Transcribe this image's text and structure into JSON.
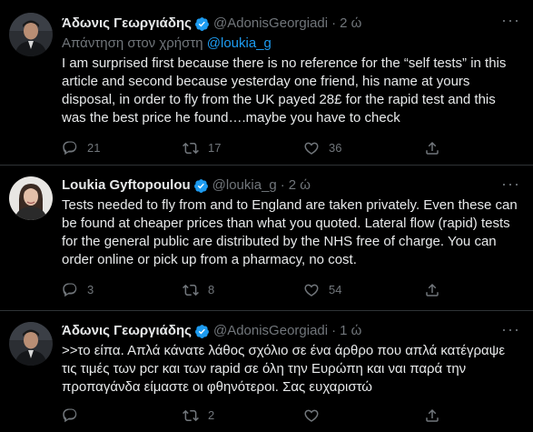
{
  "tweets": [
    {
      "name": "Άδωνις Γεωργιάδης",
      "handle": "@AdonisGeorgiadi",
      "time": "2 ώ",
      "reply_prefix": "Απάντηση στον χρήστη",
      "reply_to": "@loukia_g",
      "text": "I am surprised first because there is no reference for the “self tests” in this article and second because yesterday one friend, his name at yours disposal, in order to fly from the UK payed 28£ for the rapid test and this was the best price he found….maybe you have to check",
      "replies": "21",
      "retweets": "17",
      "likes": "36"
    },
    {
      "name": "Loukia Gyftopoulou",
      "handle": "@loukia_g",
      "time": "2 ώ",
      "text": "Tests needed to fly from and to England are taken privately. Even these can be found at cheaper prices than what you quoted. Lateral flow (rapid) tests for the general public are distributed by the NHS free of charge. You can order online or pick up from a pharmacy, no cost.",
      "replies": "3",
      "retweets": "8",
      "likes": "54"
    },
    {
      "name": "Άδωνις Γεωργιάδης",
      "handle": "@AdonisGeorgiadi",
      "time": "1 ώ",
      "text": ">>το είπα. Απλά κάνατε λάθος σχόλιο σε ένα άρθρο που απλά κατέγραψε τις τιμές των pcr και των rapid σε όλη την Ευρώπη και ναι παρά την προπαγάνδα είμαστε οι φθηνότεροι. Σας ευχαριστώ",
      "replies": "",
      "retweets": "2",
      "likes": ""
    }
  ],
  "colors": {
    "background": "#000000",
    "text": "#e7e9ea",
    "muted": "#71767b",
    "accent": "#1d9bf0",
    "divider": "#2f3336"
  },
  "icons": {
    "reply": "reply-icon",
    "retweet": "retweet-icon",
    "like": "heart-icon",
    "share": "share-icon",
    "verified": "verified-badge-icon",
    "more": "more-icon"
  }
}
